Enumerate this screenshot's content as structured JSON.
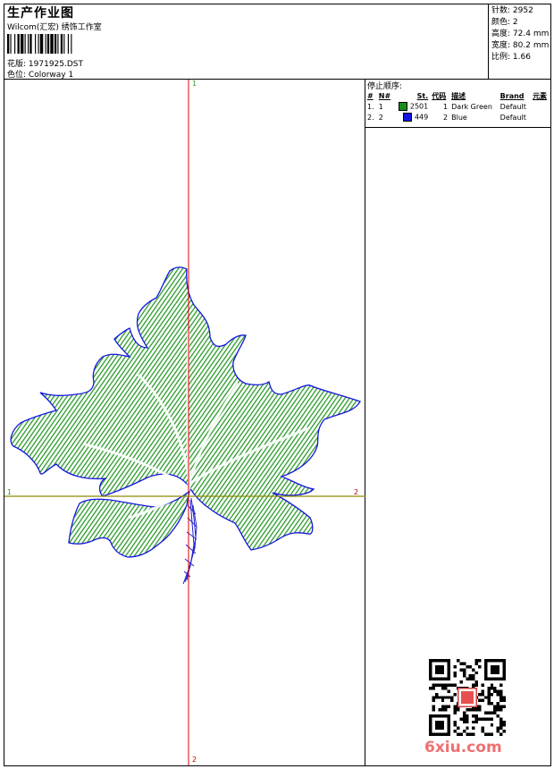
{
  "header": {
    "title": "生产作业图",
    "subtitle": "Wilcom(汇宏) 绣饰工作室",
    "design_label": "花版:",
    "design_value": "1971925.DST",
    "colorway_label": "色位:",
    "colorway_value": "Colorway 1"
  },
  "stats": {
    "stitches_label": "针数:",
    "stitches_value": "2952",
    "colors_label": "颜色:",
    "colors_value": "2",
    "height_label": "高度:",
    "height_value": "72.4 mm",
    "width_label": "宽度:",
    "width_value": "80.2 mm",
    "scale_label": "比例:",
    "scale_value": "1.66"
  },
  "stop_sequence": {
    "title": "停止顺序:",
    "columns": [
      "#",
      "N#",
      "St.",
      "代码",
      "描述",
      "Brand",
      "元素"
    ],
    "rows": [
      {
        "idx": "1.",
        "n": "1",
        "color": "#1a8c1a",
        "stitches": "2501",
        "code": "1",
        "desc": "Dark Green",
        "brand": "Default"
      },
      {
        "idx": "2.",
        "n": "2",
        "color": "#1515e0",
        "stitches": "449",
        "code": "2",
        "desc": "Blue",
        "brand": "Default"
      }
    ]
  },
  "axes": {
    "top": "1",
    "bottom": "2",
    "left": "1",
    "right": "2",
    "vertical_color": "#e00000",
    "horizontal_color": "#8c8c00"
  },
  "watermark": "6xiu.com",
  "colors": {
    "leaf_fill": "#2a9a2a",
    "leaf_outline": "#1515e0",
    "stem": "#2222cc"
  }
}
